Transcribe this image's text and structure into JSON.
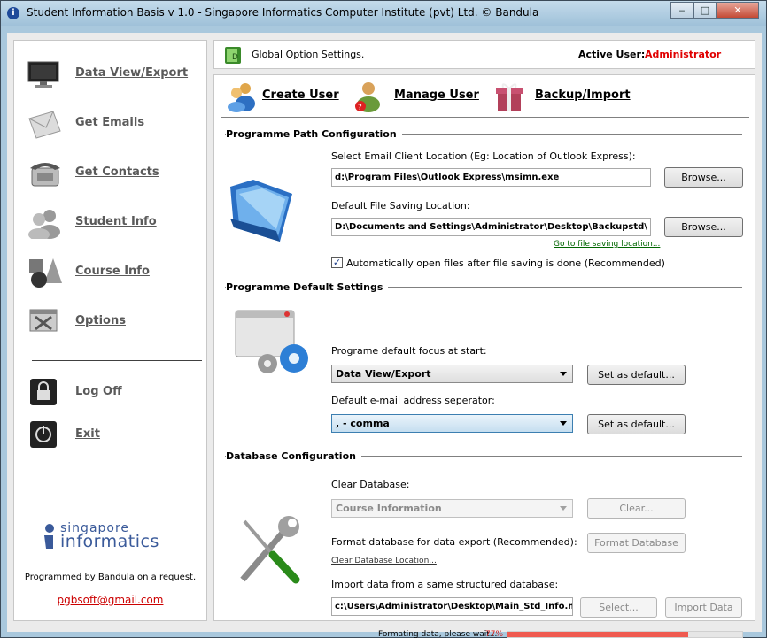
{
  "window": {
    "title": "Student Information Basis v 1.0 - Singapore Informatics Computer Institute (pvt) Ltd. ©  Bandula",
    "minimize_glyph": "‒",
    "maximize_glyph": "□",
    "close_glyph": "✕"
  },
  "sidebar": {
    "items": [
      {
        "label": "Data View/Export",
        "icon": "monitor-icon"
      },
      {
        "label": "Get Emails",
        "icon": "envelope-icon"
      },
      {
        "label": "Get Contacts",
        "icon": "phone-icon"
      },
      {
        "label": "Student Info",
        "icon": "students-icon"
      },
      {
        "label": "Course Info",
        "icon": "shapes-icon"
      },
      {
        "label": "Options",
        "icon": "options-icon"
      },
      {
        "label": "Log Off",
        "icon": "lock-icon"
      },
      {
        "label": "Exit",
        "icon": "power-icon"
      }
    ],
    "logo_line1": "singapore",
    "logo_line2": "informatics",
    "credit": "Programmed by Bandula on a request.",
    "email": "pgbsoft@gmail.com"
  },
  "header": {
    "title": "Global Option Settings.",
    "active_user_label": "Active User:",
    "active_user": "Administrator",
    "active_user_color": "#e00000"
  },
  "tabs": [
    {
      "label": "Create User",
      "icon": "users-icon"
    },
    {
      "label": "Manage User",
      "icon": "user-manage-icon"
    },
    {
      "label": "Backup/Import",
      "icon": "gift-box-icon"
    }
  ],
  "path_config": {
    "title": "Programme Path Configuration",
    "email_client_label": "Select Email Client Location (Eg: Location of Outlook Express):",
    "email_client_value": "d:\\Program Files\\Outlook Express\\msimn.exe",
    "save_location_label": "Default File Saving Location:",
    "save_location_value": "D:\\Documents and Settings\\Administrator\\Desktop\\Backupstd\\",
    "browse_label": "Browse...",
    "goto_link": "Go to file saving location...",
    "auto_open_label": "Automatically open files after file saving is done (Recommended)",
    "auto_open_checked": true
  },
  "default_settings": {
    "title": "Programme Default Settings",
    "focus_label": "Programe default focus at start:",
    "focus_value": "Data View/Export",
    "separator_label": "Default e-mail address seperator:",
    "separator_value": ", - comma",
    "set_default_label": "Set as default..."
  },
  "database": {
    "title": "Database Configuration",
    "clear_label": "Clear Database:",
    "clear_value": "Course Information",
    "clear_button": "Clear...",
    "format_label": "Format database for data export (Recommended):",
    "format_button": "Format Database",
    "clear_location_link": "Clear Database Location...",
    "import_label": "Import data from a same structured database:",
    "import_value": "c:\\Users\\Administrator\\Desktop\\Main_Std_Info.mdb",
    "select_button": "Select...",
    "import_button": "Import Data",
    "progress_text": "Formating data, please wait...",
    "progress_percent_text": "77%",
    "progress_fraction": 0.77,
    "progress_color": "#ef5a50"
  }
}
